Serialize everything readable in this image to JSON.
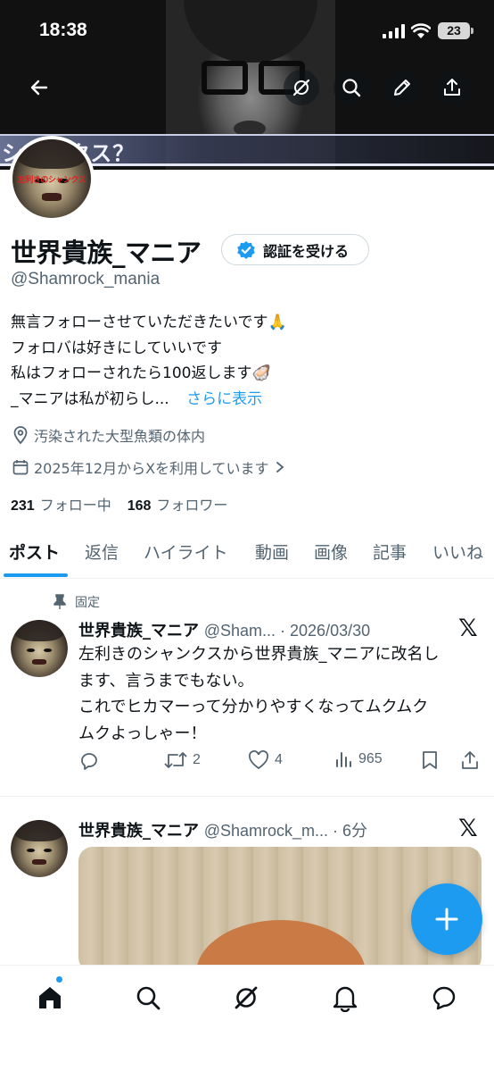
{
  "status_bar": {
    "time": "18:38",
    "battery": "23"
  },
  "banner": {
    "overlay_text": "シャンクス？"
  },
  "profile": {
    "avatar_text": "左利きのシャンクス",
    "display_name": "世界貴族_マニア",
    "verify_button": "認証を受ける",
    "handle": "@Shamrock_mania",
    "bio_lines": [
      "無言フォローさせていただきたいです🙏",
      "フォロバは好きにしていいです",
      "私はフォローされたら100返します🦪",
      "_マニアは私が初らし..."
    ],
    "bio_more": "さらに表示",
    "location": "汚染された大型魚類の体内",
    "joined": "2025年12月からXを利用しています",
    "following_count": "231",
    "following_label": "フォロー中",
    "followers_count": "168",
    "followers_label": "フォロワー"
  },
  "tabs": [
    "ポスト",
    "返信",
    "ハイライト",
    "動画",
    "画像",
    "記事",
    "いいね"
  ],
  "posts": [
    {
      "pinned_label": "固定",
      "name": "世界貴族_マニア",
      "handle_time": "@Sham... · 2026/03/30",
      "text_lines": [
        "左利きのシャンクスから世界貴族_マニアに改名し",
        "ます、言うまでもない。",
        "これでヒカマーって分かりやすくなってムクムク",
        "ムクよっしゃー！"
      ],
      "retweets": "2",
      "likes": "4",
      "views": "965"
    },
    {
      "name": "世界貴族_マニア",
      "handle_time": "@Shamrock_m... · 6分"
    }
  ],
  "icons": [
    "back-arrow-icon",
    "grok-icon",
    "search-icon",
    "edit-icon",
    "share-icon",
    "pin-icon",
    "location-icon",
    "calendar-icon",
    "reply-icon",
    "retweet-icon",
    "like-icon",
    "views-icon",
    "bookmark-icon",
    "home-icon",
    "notifications-icon",
    "messages-icon",
    "plus-icon"
  ],
  "colors": {
    "accent": "#1d9bf0",
    "text": "#0f1419",
    "muted": "#536471"
  }
}
